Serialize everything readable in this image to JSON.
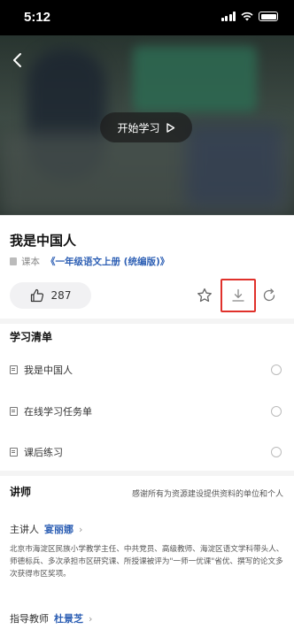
{
  "status_bar": {
    "time": "5:12"
  },
  "video": {
    "play_label": "开始学习"
  },
  "lesson": {
    "title": "我是中国人",
    "type_label": "课本",
    "book_link": "《一年级语文上册 (统编版)》",
    "like_count": "287"
  },
  "study_list": {
    "title": "学习清单",
    "items": [
      {
        "label": "我是中国人"
      },
      {
        "label": "在线学习任务单"
      },
      {
        "label": "课后练习"
      }
    ]
  },
  "lecturer": {
    "title": "讲师",
    "thanks": "感谢所有为资源建设提供资料的单位和个人",
    "main_role": "主讲人",
    "main_name": "宴丽娜",
    "bio": "北京市海淀区民族小学教学主任、中共党员、高级教师、海淀区语文学科带头人、师德标兵、多次承担市区研究课、所授课被评为\"一师一优课\"省优、撰写的论文多次获得市区奖项。",
    "guide_role": "指导教师",
    "guide_name": "杜景芝"
  },
  "colors": {
    "accent_blue": "#2d5fb4",
    "highlight_red": "#e0312b"
  }
}
